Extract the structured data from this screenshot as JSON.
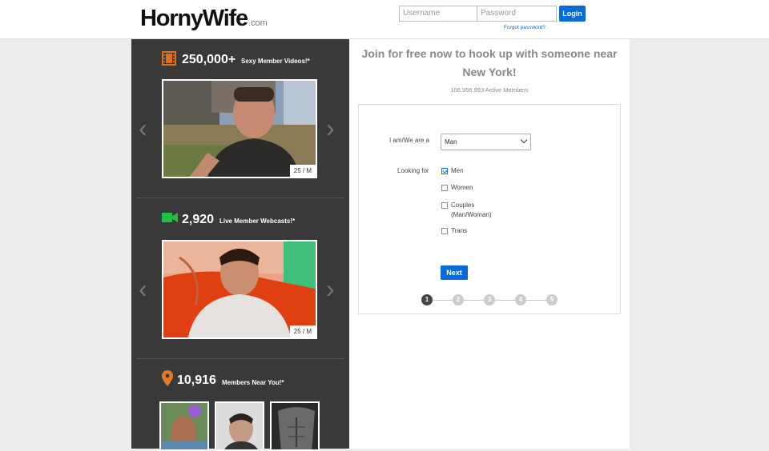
{
  "header": {
    "logo": "HornyWife",
    "logo_suffix": ".com",
    "username_placeholder": "Username",
    "password_placeholder": "Password",
    "login_label": "Login",
    "forgot_label": "Forgot password?"
  },
  "left": {
    "videos": {
      "count": "250,000+",
      "label": "Sexy Member Videos!*",
      "badge": "25 / M"
    },
    "webcams": {
      "count": "2,920",
      "label": "Live Member Webcasts!*",
      "badge": "25 / M"
    },
    "members": {
      "count": "10,916",
      "label": "Members Near You!*"
    }
  },
  "signup": {
    "title": "Join for free now to hook up with someone near New York!",
    "active_members": "106,956,993 Active Members",
    "iam_label": "I am/We are a",
    "iam_value": "Man",
    "looking_label": "Looking for",
    "options": [
      {
        "label": "Men",
        "checked": true
      },
      {
        "label": "Women",
        "checked": false
      },
      {
        "label": "Couples",
        "sub": "(Man/Woman)",
        "checked": false
      },
      {
        "label": "Trans",
        "checked": false
      }
    ],
    "next_label": "Next",
    "steps": [
      "1",
      "2",
      "3",
      "4",
      "5"
    ],
    "current_step": 1
  },
  "colors": {
    "accent": "#0a6bd6",
    "panel": "#3a3939",
    "video_icon": "#e0701d",
    "webcam_icon": "#20c040",
    "pin_icon": "#e57b22"
  }
}
